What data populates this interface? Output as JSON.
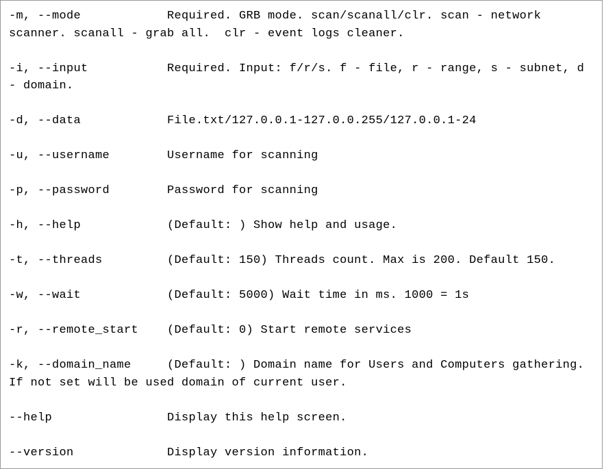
{
  "lines": {
    "mode": "-m, --mode            Required. GRB mode. scan/scanall/clr. scan - network scanner. scanall - grab all.  clr - event logs cleaner.",
    "blank1": " ",
    "input": "-i, --input           Required. Input: f/r/s. f - file, r - range, s - subnet, d - domain.",
    "blank2": " ",
    "data": "-d, --data            File.txt/127.0.0.1-127.0.0.255/127.0.0.1-24",
    "blank3": " ",
    "username": "-u, --username        Username for scanning",
    "blank4": " ",
    "password": "-p, --password        Password for scanning",
    "blank5": " ",
    "help_flag": "-h, --help            (Default: ) Show help and usage.",
    "blank6": " ",
    "threads": "-t, --threads         (Default: 150) Threads count. Max is 200. Default 150.",
    "blank7": " ",
    "wait": "-w, --wait            (Default: 5000) Wait time in ms. 1000 = 1s",
    "blank8": " ",
    "remote_start": "-r, --remote_start    (Default: 0) Start remote services",
    "blank9": " ",
    "domain_name": "-k, --domain_name     (Default: ) Domain name for Users and Computers gathering. If not set will be used domain of current user.",
    "blank10": " ",
    "help": "--help                Display this help screen.",
    "blank11": " ",
    "version": "--version             Display version information."
  }
}
